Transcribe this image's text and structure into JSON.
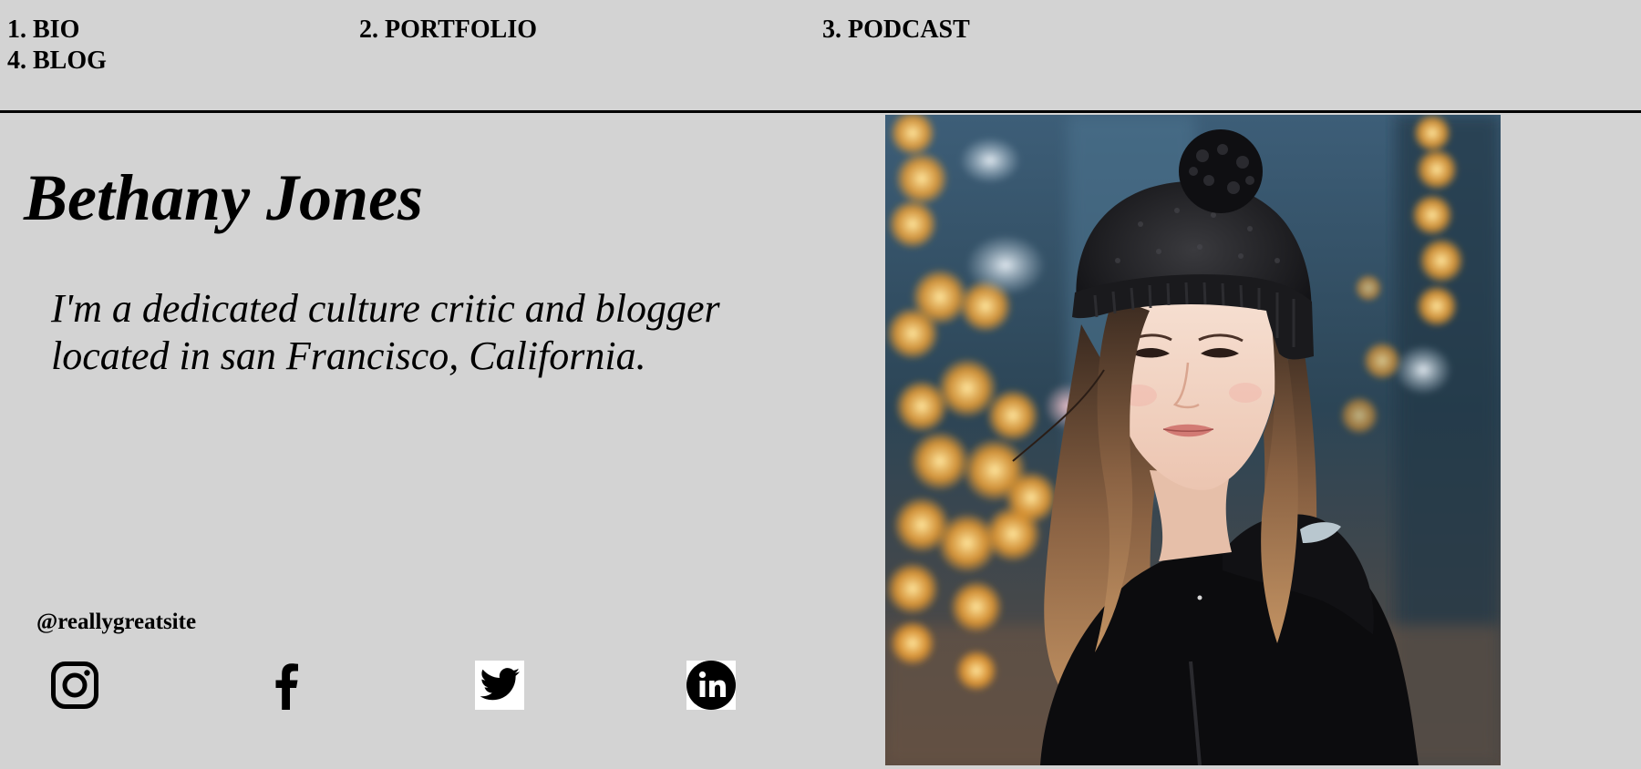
{
  "nav": {
    "items": [
      {
        "label": "1. BIO"
      },
      {
        "label": "2. PORTFOLIO"
      },
      {
        "label": "3. PODCAST"
      },
      {
        "label": "4. BLOG"
      }
    ]
  },
  "hero": {
    "name": "Bethany Jones",
    "tagline": "I'm a dedicated culture critic and blogger located in san Francisco, California."
  },
  "social": {
    "handle": "@reallygreatsite",
    "icons": [
      "instagram-icon",
      "facebook-icon",
      "twitter-icon",
      "linkedin-icon"
    ]
  },
  "photo": {
    "alt": "Portrait of a young woman with long hair wearing a black knit beanie and black hoodie, with blurred city lights behind her"
  },
  "colors": {
    "background": "#d3d3d3",
    "text": "#000000",
    "divider": "#000000"
  }
}
